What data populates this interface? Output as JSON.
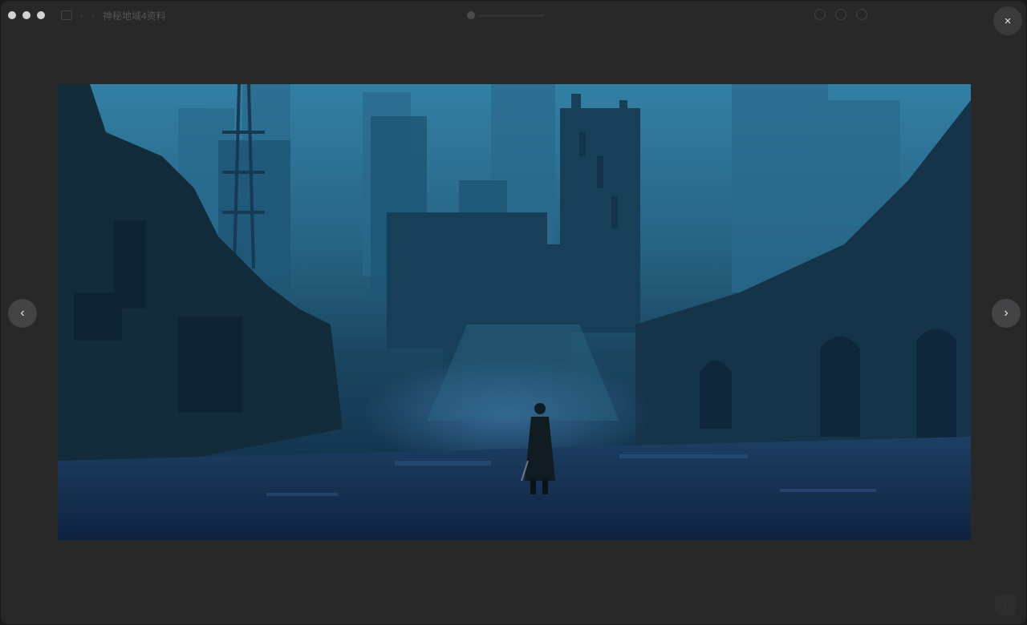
{
  "window": {
    "breadcrumb": {
      "title": "神秘地域4资料"
    },
    "controls": {
      "close_symbol": "×",
      "prev_symbol": "‹",
      "next_symbol": "›"
    }
  },
  "viewer": {
    "image_subject": "dark fantasy city street concept art with a lone cloaked figure",
    "icons": [
      "close-icon",
      "chevron-left-icon",
      "chevron-right-icon"
    ]
  }
}
